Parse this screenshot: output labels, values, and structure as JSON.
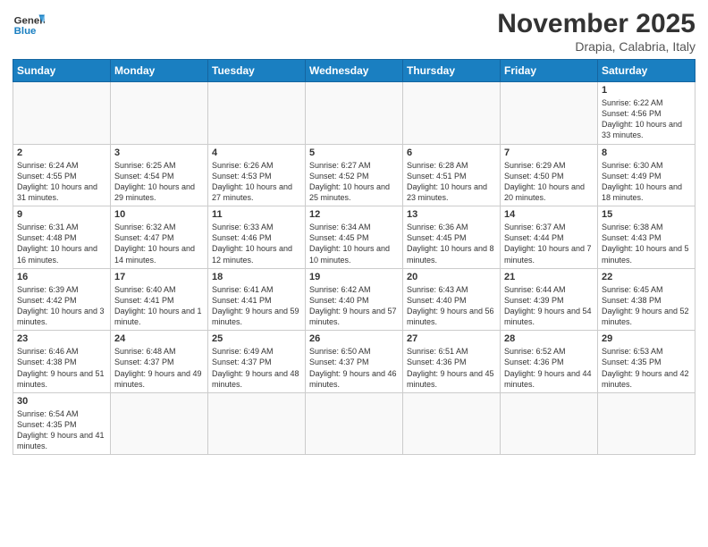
{
  "logo": {
    "line1": "General",
    "line2": "Blue"
  },
  "header": {
    "month": "November 2025",
    "location": "Drapia, Calabria, Italy"
  },
  "weekdays": [
    "Sunday",
    "Monday",
    "Tuesday",
    "Wednesday",
    "Thursday",
    "Friday",
    "Saturday"
  ],
  "weeks": [
    [
      {
        "day": "",
        "info": ""
      },
      {
        "day": "",
        "info": ""
      },
      {
        "day": "",
        "info": ""
      },
      {
        "day": "",
        "info": ""
      },
      {
        "day": "",
        "info": ""
      },
      {
        "day": "",
        "info": ""
      },
      {
        "day": "1",
        "info": "Sunrise: 6:22 AM\nSunset: 4:56 PM\nDaylight: 10 hours and 33 minutes."
      }
    ],
    [
      {
        "day": "2",
        "info": "Sunrise: 6:24 AM\nSunset: 4:55 PM\nDaylight: 10 hours and 31 minutes."
      },
      {
        "day": "3",
        "info": "Sunrise: 6:25 AM\nSunset: 4:54 PM\nDaylight: 10 hours and 29 minutes."
      },
      {
        "day": "4",
        "info": "Sunrise: 6:26 AM\nSunset: 4:53 PM\nDaylight: 10 hours and 27 minutes."
      },
      {
        "day": "5",
        "info": "Sunrise: 6:27 AM\nSunset: 4:52 PM\nDaylight: 10 hours and 25 minutes."
      },
      {
        "day": "6",
        "info": "Sunrise: 6:28 AM\nSunset: 4:51 PM\nDaylight: 10 hours and 23 minutes."
      },
      {
        "day": "7",
        "info": "Sunrise: 6:29 AM\nSunset: 4:50 PM\nDaylight: 10 hours and 20 minutes."
      },
      {
        "day": "8",
        "info": "Sunrise: 6:30 AM\nSunset: 4:49 PM\nDaylight: 10 hours and 18 minutes."
      }
    ],
    [
      {
        "day": "9",
        "info": "Sunrise: 6:31 AM\nSunset: 4:48 PM\nDaylight: 10 hours and 16 minutes."
      },
      {
        "day": "10",
        "info": "Sunrise: 6:32 AM\nSunset: 4:47 PM\nDaylight: 10 hours and 14 minutes."
      },
      {
        "day": "11",
        "info": "Sunrise: 6:33 AM\nSunset: 4:46 PM\nDaylight: 10 hours and 12 minutes."
      },
      {
        "day": "12",
        "info": "Sunrise: 6:34 AM\nSunset: 4:45 PM\nDaylight: 10 hours and 10 minutes."
      },
      {
        "day": "13",
        "info": "Sunrise: 6:36 AM\nSunset: 4:45 PM\nDaylight: 10 hours and 8 minutes."
      },
      {
        "day": "14",
        "info": "Sunrise: 6:37 AM\nSunset: 4:44 PM\nDaylight: 10 hours and 7 minutes."
      },
      {
        "day": "15",
        "info": "Sunrise: 6:38 AM\nSunset: 4:43 PM\nDaylight: 10 hours and 5 minutes."
      }
    ],
    [
      {
        "day": "16",
        "info": "Sunrise: 6:39 AM\nSunset: 4:42 PM\nDaylight: 10 hours and 3 minutes."
      },
      {
        "day": "17",
        "info": "Sunrise: 6:40 AM\nSunset: 4:41 PM\nDaylight: 10 hours and 1 minute."
      },
      {
        "day": "18",
        "info": "Sunrise: 6:41 AM\nSunset: 4:41 PM\nDaylight: 9 hours and 59 minutes."
      },
      {
        "day": "19",
        "info": "Sunrise: 6:42 AM\nSunset: 4:40 PM\nDaylight: 9 hours and 57 minutes."
      },
      {
        "day": "20",
        "info": "Sunrise: 6:43 AM\nSunset: 4:40 PM\nDaylight: 9 hours and 56 minutes."
      },
      {
        "day": "21",
        "info": "Sunrise: 6:44 AM\nSunset: 4:39 PM\nDaylight: 9 hours and 54 minutes."
      },
      {
        "day": "22",
        "info": "Sunrise: 6:45 AM\nSunset: 4:38 PM\nDaylight: 9 hours and 52 minutes."
      }
    ],
    [
      {
        "day": "23",
        "info": "Sunrise: 6:46 AM\nSunset: 4:38 PM\nDaylight: 9 hours and 51 minutes."
      },
      {
        "day": "24",
        "info": "Sunrise: 6:48 AM\nSunset: 4:37 PM\nDaylight: 9 hours and 49 minutes."
      },
      {
        "day": "25",
        "info": "Sunrise: 6:49 AM\nSunset: 4:37 PM\nDaylight: 9 hours and 48 minutes."
      },
      {
        "day": "26",
        "info": "Sunrise: 6:50 AM\nSunset: 4:37 PM\nDaylight: 9 hours and 46 minutes."
      },
      {
        "day": "27",
        "info": "Sunrise: 6:51 AM\nSunset: 4:36 PM\nDaylight: 9 hours and 45 minutes."
      },
      {
        "day": "28",
        "info": "Sunrise: 6:52 AM\nSunset: 4:36 PM\nDaylight: 9 hours and 44 minutes."
      },
      {
        "day": "29",
        "info": "Sunrise: 6:53 AM\nSunset: 4:35 PM\nDaylight: 9 hours and 42 minutes."
      }
    ],
    [
      {
        "day": "30",
        "info": "Sunrise: 6:54 AM\nSunset: 4:35 PM\nDaylight: 9 hours and 41 minutes."
      },
      {
        "day": "",
        "info": ""
      },
      {
        "day": "",
        "info": ""
      },
      {
        "day": "",
        "info": ""
      },
      {
        "day": "",
        "info": ""
      },
      {
        "day": "",
        "info": ""
      },
      {
        "day": "",
        "info": ""
      }
    ]
  ]
}
